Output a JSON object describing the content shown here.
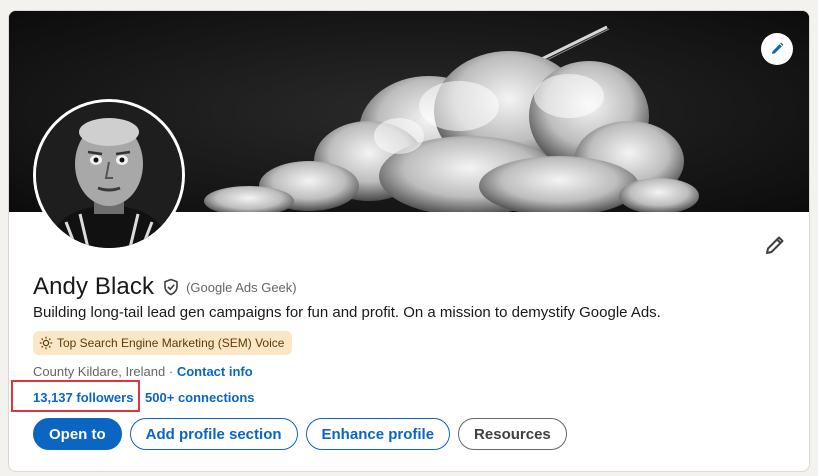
{
  "profile": {
    "name": "Andy Black",
    "pronouns": "(Google Ads Geek)",
    "headline": "Building long-tail lead gen campaigns for fun and profit. On a mission to demystify Google Ads.",
    "badge": "Top Search Engine Marketing (SEM) Voice",
    "location": "County Kildare, Ireland",
    "location_separator": "·",
    "contact_info": "Contact info",
    "followers": "13,137 followers",
    "stats_separator": "·",
    "connections": "500+ connections"
  },
  "actions": {
    "open_to": "Open to",
    "add_section": "Add profile section",
    "enhance": "Enhance profile",
    "resources": "Resources"
  },
  "icons": {
    "banner_edit": "pencil-icon",
    "profile_edit": "pencil-icon",
    "verified": "shield-check-icon",
    "badge": "sun-icon"
  },
  "colors": {
    "primary": "#0a66c2",
    "badge_bg": "#fbe7c6",
    "highlight": "#e0353f"
  }
}
